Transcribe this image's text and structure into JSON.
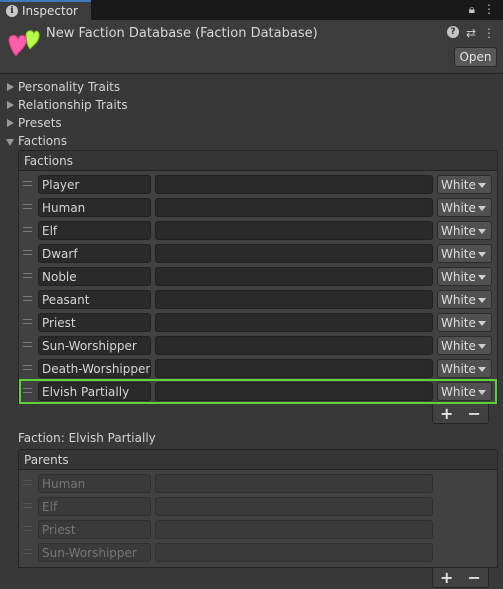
{
  "tab": {
    "label": "Inspector"
  },
  "header": {
    "title": "New Faction Database (Faction Database)",
    "open_label": "Open"
  },
  "foldouts": [
    {
      "label": "Personality Traits",
      "expanded": false
    },
    {
      "label": "Relationship Traits",
      "expanded": false
    },
    {
      "label": "Presets",
      "expanded": false
    },
    {
      "label": "Factions",
      "expanded": true
    }
  ],
  "factions_list": {
    "header": "Factions",
    "rows": [
      {
        "name": "Player",
        "value": "",
        "color": "White"
      },
      {
        "name": "Human",
        "value": "",
        "color": "White"
      },
      {
        "name": "Elf",
        "value": "",
        "color": "White"
      },
      {
        "name": "Dwarf",
        "value": "",
        "color": "White"
      },
      {
        "name": "Noble",
        "value": "",
        "color": "White"
      },
      {
        "name": "Peasant",
        "value": "",
        "color": "White"
      },
      {
        "name": "Priest",
        "value": "",
        "color": "White"
      },
      {
        "name": "Sun-Worshipper",
        "value": "",
        "color": "White"
      },
      {
        "name": "Death-Worshipper",
        "value": "",
        "color": "White"
      },
      {
        "name": "Elvish Partially",
        "value": "",
        "color": "White",
        "selected": true
      }
    ],
    "add_label": "+",
    "remove_label": "−"
  },
  "faction_detail": {
    "title": "Faction: Elvish Partially",
    "parents_header": "Parents",
    "parents": [
      {
        "name": "Human",
        "value": ""
      },
      {
        "name": "Elf",
        "value": ""
      },
      {
        "name": "Priest",
        "value": ""
      },
      {
        "name": "Sun-Worshipper",
        "value": ""
      }
    ],
    "add_label": "+",
    "remove_label": "−"
  },
  "colors": {
    "selection_outline": "#5bd235",
    "tab_accent": "#3a79bb",
    "heart_pink": "#ff5fa8",
    "heart_green": "#b6ff4a"
  }
}
